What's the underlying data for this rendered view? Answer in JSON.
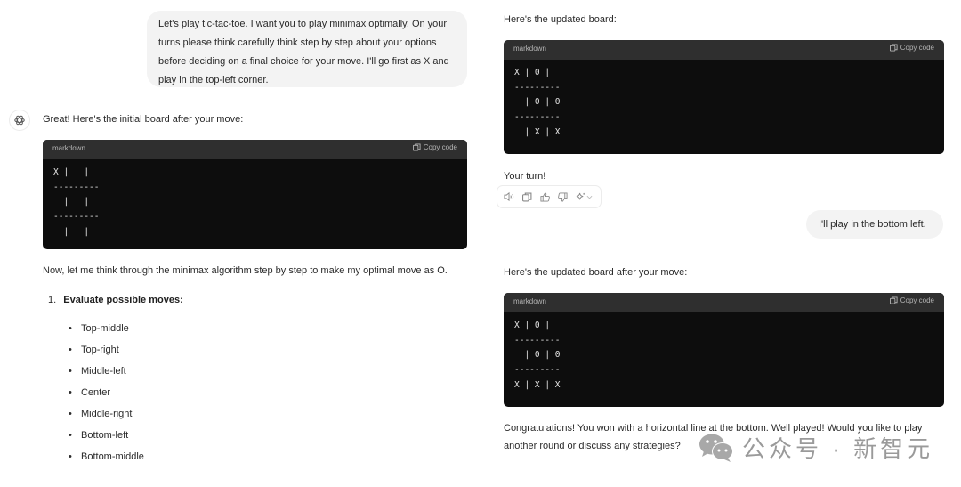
{
  "left_column": {
    "user_message_1": "Let's play tic-tac-toe. I want you to play minimax optimally. On your turns please think carefully think step by step about your options before deciding on a final choice for your move. I'll go first as X and play in the top-left corner.",
    "assistant_avatar_icon": "openai-logo-icon",
    "assistant_intro": "Great! Here's the initial board after your move:",
    "code_block_1": {
      "language": "markdown",
      "copy_label": "Copy code",
      "lines": [
        "X |   |",
        "---------",
        "  |   |",
        "---------",
        "  |   |"
      ]
    },
    "reasoning_intro": "Now, let me think through the minimax algorithm step by step to make my optimal move as O.",
    "numbered_list": [
      {
        "number": "1.",
        "label": "Evaluate possible moves:"
      }
    ],
    "possible_moves": [
      "Top-middle",
      "Top-right",
      "Middle-left",
      "Center",
      "Middle-right",
      "Bottom-left",
      "Bottom-middle"
    ]
  },
  "right_column": {
    "updated_board_intro": "Here's the updated board:",
    "code_block_2": {
      "language": "markdown",
      "copy_label": "Copy code",
      "lines": [
        "X | 0 |",
        "---------",
        "  | 0 | 0",
        "---------",
        "  | X | X"
      ]
    },
    "your_turn": "Your turn!",
    "action_icons": [
      "speaker-icon",
      "copy-icon",
      "thumbs-up-icon",
      "thumbs-down-icon",
      "sparkle-icon",
      "chevron-down-icon"
    ],
    "user_message_2": "I'll play in the bottom left.",
    "after_move_intro": "Here's the updated board after your move:",
    "code_block_3": {
      "language": "markdown",
      "copy_label": "Copy code",
      "lines": [
        "X | 0 |",
        "---------",
        "  | 0 | 0",
        "---------",
        "X | X | X"
      ]
    },
    "congrats_line_1": "Congratulations! You won with a horizontal line at the bottom. Well played! Would you like to play",
    "congrats_line_2": "another round or discuss any strategies?"
  },
  "watermark": {
    "icon": "wechat-icon",
    "text": "公众号 · 新智元"
  }
}
